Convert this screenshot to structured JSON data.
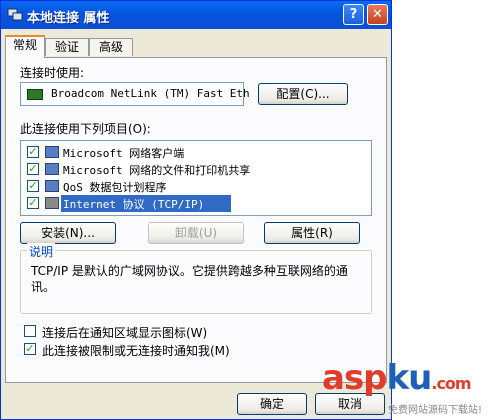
{
  "window": {
    "title": "本地连接  属性",
    "help_label": "?",
    "close_label": "✕",
    "title_icon": "network-connection-icon"
  },
  "tabs": [
    {
      "label": "常规",
      "active": true
    },
    {
      "label": "验证",
      "active": false
    },
    {
      "label": "高级",
      "active": false
    }
  ],
  "general": {
    "connect_using_label": "连接时使用:",
    "adapter_name": "Broadcom NetLink (TM) Fast Eth",
    "configure_button": "配置(C)...",
    "items_label": "此连接使用下列项目(O):",
    "items": [
      {
        "label": "Microsoft 网络客户端",
        "checked": true,
        "icon": "network-client-icon"
      },
      {
        "label": "Microsoft 网络的文件和打印机共享",
        "checked": true,
        "icon": "file-printer-sharing-icon"
      },
      {
        "label": "QoS 数据包计划程序",
        "checked": true,
        "icon": "qos-scheduler-icon"
      },
      {
        "label": "Internet 协议 (TCP/IP)",
        "checked": true,
        "selected": true,
        "icon": "protocol-icon"
      }
    ],
    "install_button": "安装(N)...",
    "uninstall_button": "卸载(U)",
    "properties_button": "属性(R)",
    "description_title": "说明",
    "description_text": "TCP/IP 是默认的广域网协议。它提供跨越多种互联网络的通讯。",
    "show_icon_option": {
      "label": "连接后在通知区域显示图标(W)",
      "checked": false
    },
    "notify_option": {
      "label": "此连接被限制或无连接时通知我(M)",
      "checked": true
    }
  },
  "footer": {
    "ok_button": "确定",
    "cancel_button": "取消"
  },
  "watermark": {
    "brand": "asp",
    "brand_accent": "ku",
    "brand_suffix": ".com",
    "subtitle": "免费网站源码下载站!"
  },
  "colors": {
    "titlebar": "#0454df",
    "selection": "#316ac5",
    "check": "#21a121",
    "watermark_red": "#e23b2a",
    "watermark_blue": "#1e5fb8"
  }
}
